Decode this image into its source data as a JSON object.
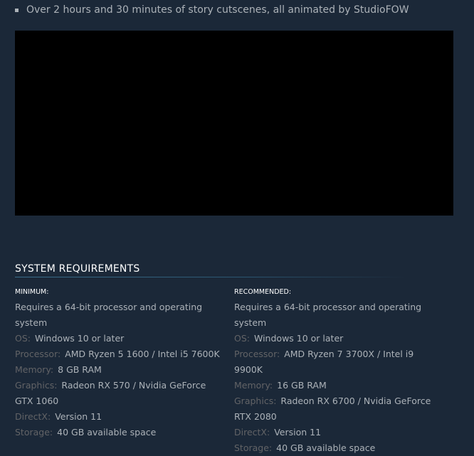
{
  "feature_bullet": "Over 2 hours and 30 minutes of story cutscenes, all animated by StudioFOW",
  "sysreq": {
    "title": "SYSTEM REQUIREMENTS",
    "minimum": {
      "heading": "MINIMUM:",
      "note": "Requires a 64-bit processor and operating system",
      "rows": [
        {
          "label": "OS:",
          "value": "Windows 10 or later"
        },
        {
          "label": "Processor:",
          "value": "AMD Ryzen 5 1600 / Intel i5 7600K"
        },
        {
          "label": "Memory:",
          "value": "8 GB RAM"
        },
        {
          "label": "Graphics:",
          "value": "Radeon RX 570 / Nvidia GeForce GTX 1060"
        },
        {
          "label": "DirectX:",
          "value": "Version 11"
        },
        {
          "label": "Storage:",
          "value": "40 GB available space"
        }
      ]
    },
    "recommended": {
      "heading": "RECOMMENDED:",
      "note": "Requires a 64-bit processor and operating system",
      "rows": [
        {
          "label": "OS:",
          "value": "Windows 10 or later"
        },
        {
          "label": "Processor:",
          "value": "AMD Ryzen 7 3700X / Intel i9 9900K"
        },
        {
          "label": "Memory:",
          "value": "16 GB RAM"
        },
        {
          "label": "Graphics:",
          "value": "Radeon RX 6700 / Nvidia GeForce RTX 2080"
        },
        {
          "label": "DirectX:",
          "value": "Version 11"
        },
        {
          "label": "Storage:",
          "value": "40 GB available space"
        }
      ]
    }
  },
  "colors": {
    "background": "#1b2838",
    "text": "#acb2b8",
    "label": "#626366",
    "heading": "#ffffff",
    "video": "#000000"
  }
}
